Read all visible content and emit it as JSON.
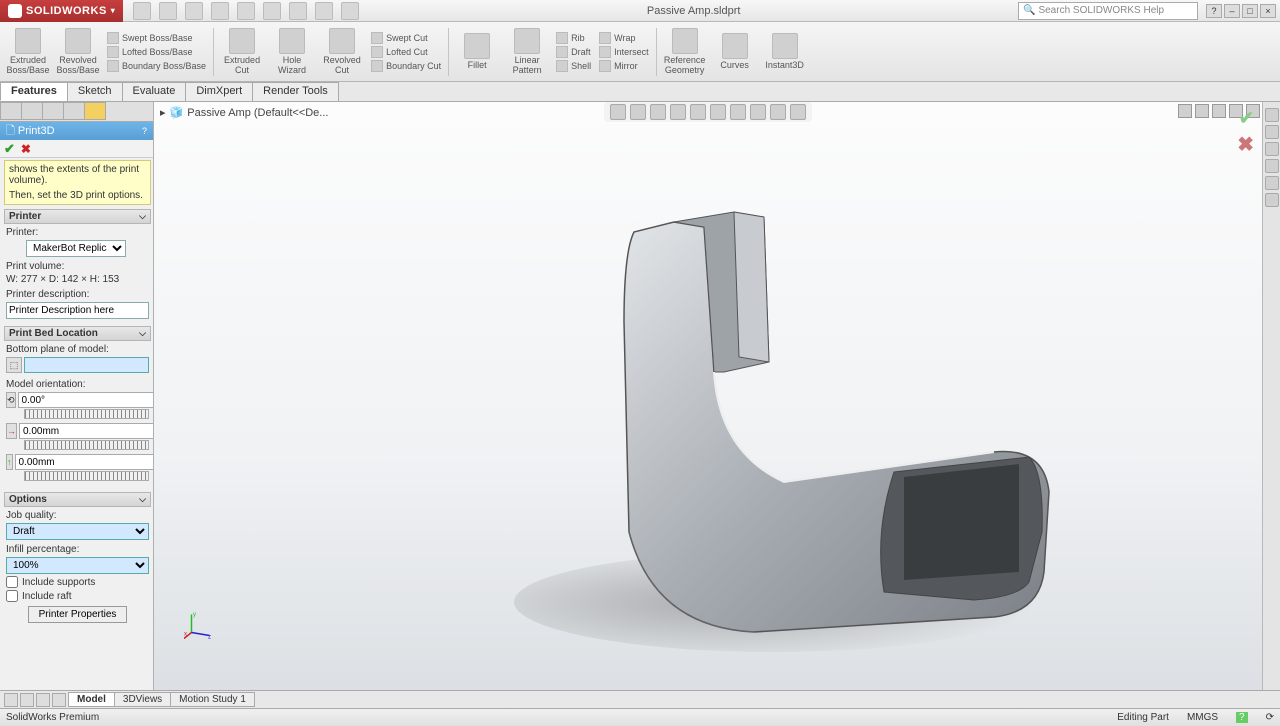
{
  "app": {
    "name": "SOLIDWORKS",
    "doc_title": "Passive Amp.sldprt",
    "search_placeholder": "Search SOLIDWORKS Help"
  },
  "ribbon": {
    "big": [
      {
        "label": "Extruded\nBoss/Base"
      },
      {
        "label": "Revolved\nBoss/Base"
      }
    ],
    "bossgrp": [
      {
        "label": "Swept Boss/Base"
      },
      {
        "label": "Lofted Boss/Base"
      },
      {
        "label": "Boundary Boss/Base"
      }
    ],
    "cutbig": [
      {
        "label": "Extruded\nCut"
      },
      {
        "label": "Hole\nWizard"
      },
      {
        "label": "Revolved\nCut"
      }
    ],
    "cutgrp": [
      {
        "label": "Swept Cut"
      },
      {
        "label": "Lofted Cut"
      },
      {
        "label": "Boundary Cut"
      }
    ],
    "feat": [
      {
        "label": "Fillet"
      },
      {
        "label": "Linear\nPattern"
      }
    ],
    "featgrp": [
      {
        "label": "Rib"
      },
      {
        "label": "Draft"
      },
      {
        "label": "Shell"
      }
    ],
    "featgrp2": [
      {
        "label": "Wrap"
      },
      {
        "label": "Intersect"
      },
      {
        "label": "Mirror"
      }
    ],
    "ref": [
      {
        "label": "Reference\nGeometry"
      },
      {
        "label": "Curves"
      },
      {
        "label": "Instant3D"
      }
    ],
    "tabs": [
      "Features",
      "Sketch",
      "Evaluate",
      "DimXpert",
      "Render Tools"
    ]
  },
  "crumb": "Passive Amp  (Default<<De...",
  "pm": {
    "title": "Print3D",
    "hint1": "shows the extents of the print volume).",
    "hint2": "Then, set the 3D print options.",
    "printer_hd": "Printer",
    "printer_lbl": "Printer:",
    "printer_sel": "MakerBot Replicato",
    "vol_lbl": "Print volume:",
    "vol_val": "W: 277 × D: 142 × H: 153",
    "desc_lbl": "Printer description:",
    "desc_val": "Printer Description here",
    "bed_hd": "Print Bed Location",
    "bottom_lbl": "Bottom plane of model:",
    "orient_lbl": "Model orientation:",
    "angle_val": "0.00°",
    "off1_val": "0.00mm",
    "off2_val": "0.00mm",
    "opt_hd": "Options",
    "jq_lbl": "Job quality:",
    "jq_val": "Draft",
    "infill_lbl": "Infill percentage:",
    "infill_val": "100%",
    "supports": "Include supports",
    "raft": "Include raft",
    "props_btn": "Printer Properties"
  },
  "bottom": {
    "tabs": [
      "Model",
      "3DViews",
      "Motion Study 1"
    ]
  },
  "status": {
    "left": "SolidWorks Premium",
    "mode": "Editing Part",
    "units": "MMGS"
  }
}
